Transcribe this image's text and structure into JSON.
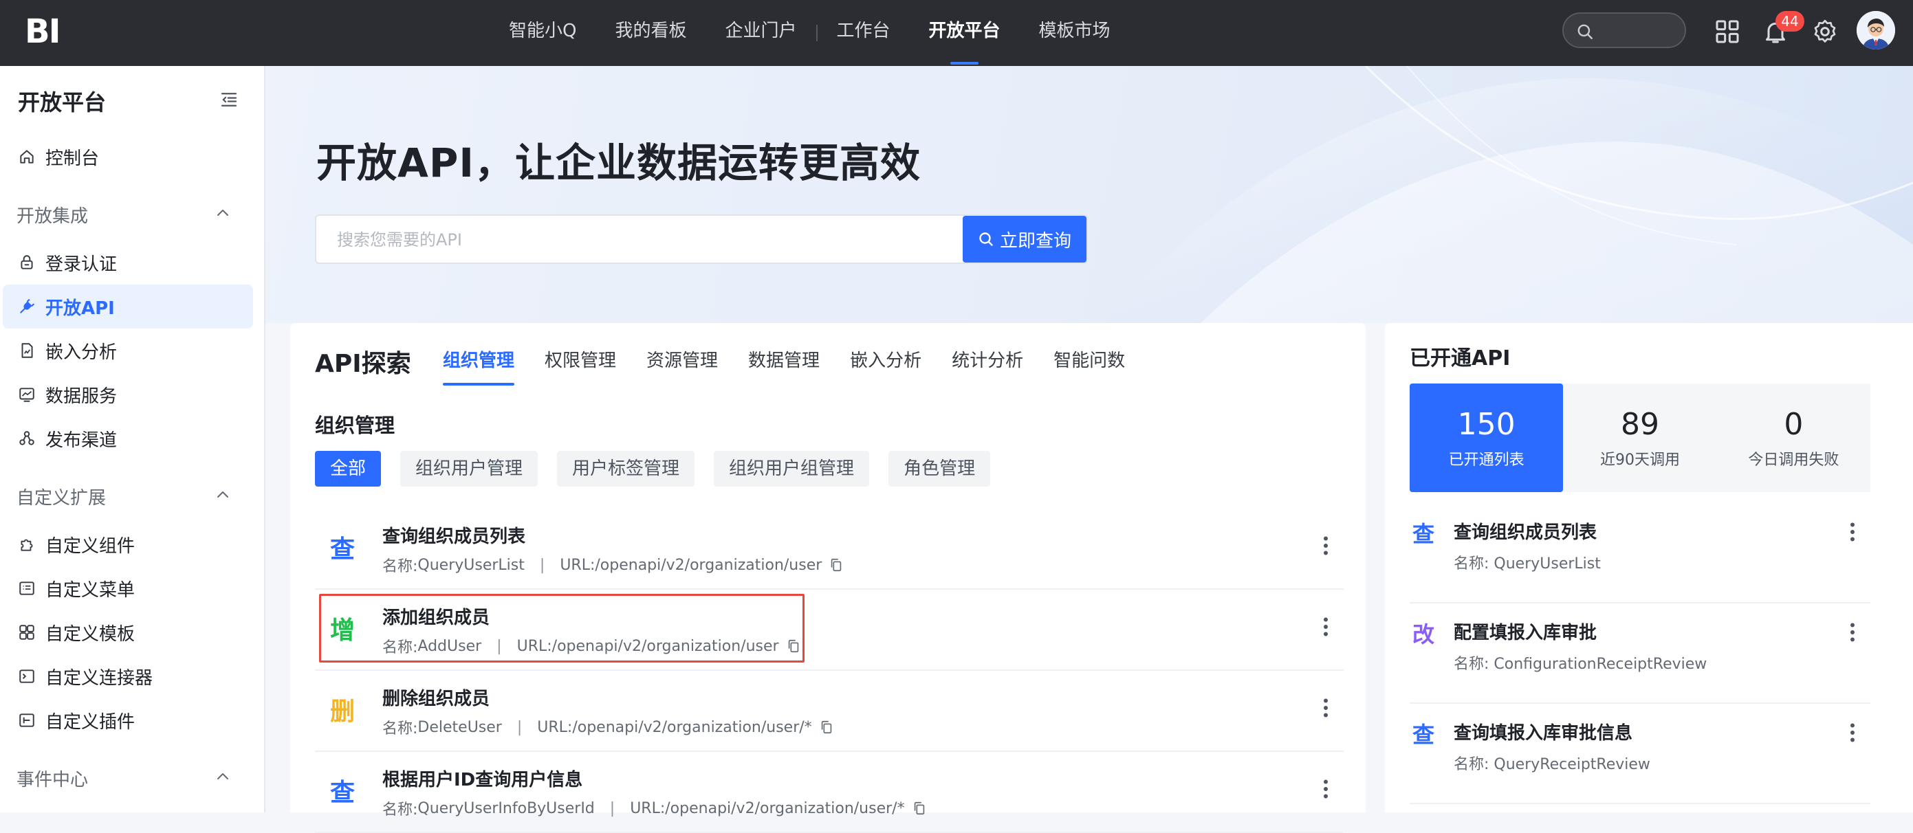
{
  "topbar": {
    "logo": "BI",
    "nav": [
      "智能小Q",
      "我的看板",
      "企业门户",
      "工作台",
      "开放平台",
      "模板市场"
    ],
    "active_nav": "开放平台",
    "notification_count": "44"
  },
  "sidebar": {
    "title": "开放平台",
    "console": "控制台",
    "group1": {
      "label": "开放集成",
      "items": [
        "登录认证",
        "开放API",
        "嵌入分析",
        "数据服务",
        "发布渠道"
      ]
    },
    "group2": {
      "label": "自定义扩展",
      "items": [
        "自定义组件",
        "自定义菜单",
        "自定义模板",
        "自定义连接器",
        "自定义插件"
      ]
    },
    "group3": {
      "label": "事件中心"
    },
    "active_item": "开放API"
  },
  "banner": {
    "title": "开放API，让企业数据运转更高效",
    "search_placeholder": "搜索您需要的API",
    "search_button": "立即查询"
  },
  "explore": {
    "title": "API探索",
    "tabs": [
      "组织管理",
      "权限管理",
      "资源管理",
      "数据管理",
      "嵌入分析",
      "统计分析",
      "智能问数"
    ],
    "active_tab": "组织管理",
    "section_title": "组织管理",
    "filters": [
      "全部",
      "组织用户管理",
      "用户标签管理",
      "组织用户组管理",
      "角色管理"
    ],
    "name_prefix": "名称: ",
    "url_prefix": "URL: ",
    "separator": "|",
    "apis": [
      {
        "kind": "查",
        "kind_color": "#2c6bff",
        "title": "查询组织成员列表",
        "name": "QueryUserList",
        "url": "/openapi/v2/organization/user"
      },
      {
        "kind": "增",
        "kind_color": "#1fbf4c",
        "title": "添加组织成员",
        "name": "AddUser",
        "url": "/openapi/v2/organization/user"
      },
      {
        "kind": "删",
        "kind_color": "#f5b41e",
        "title": "删除组织成员",
        "name": "DeleteUser",
        "url": "/openapi/v2/organization/user/*"
      },
      {
        "kind": "查",
        "kind_color": "#2c6bff",
        "title": "根据用户ID查询用户信息",
        "name": "QueryUserInfoByUserId",
        "url": "/openapi/v2/organization/user/*"
      }
    ]
  },
  "opened": {
    "title": "已开通API",
    "stats": [
      {
        "value": "150",
        "label": "已开通列表"
      },
      {
        "value": "89",
        "label": "近90天调用"
      },
      {
        "value": "0",
        "label": "今日调用失败"
      }
    ],
    "items": [
      {
        "kind": "查",
        "kind_color": "#2c6bff",
        "title": "查询组织成员列表",
        "meta": "名称: QueryUserList"
      },
      {
        "kind": "改",
        "kind_color": "#8b5cf6",
        "title": "配置填报入库审批",
        "meta": "名称: ConfigurationReceiptReview"
      },
      {
        "kind": "查",
        "kind_color": "#2c6bff",
        "title": "查询填报入库审批信息",
        "meta": "名称: QueryReceiptReview"
      }
    ]
  },
  "colors": {
    "primary": "#2c6bff",
    "topbar": "#2b2d33",
    "highlight_box": "#e5483d",
    "badge": "#f54a45"
  }
}
